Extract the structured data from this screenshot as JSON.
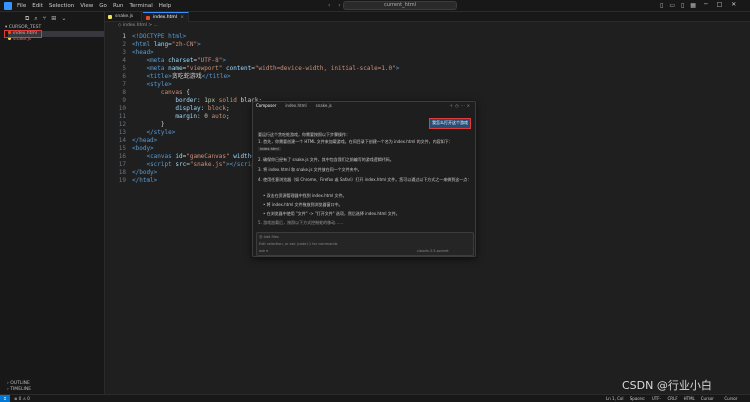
{
  "menu": [
    "File",
    "Edit",
    "Selection",
    "View",
    "Go",
    "Run",
    "Terminal",
    "Help"
  ],
  "command_center": "current_html",
  "sidebar": {
    "header": "CURSOR_TEST",
    "files": [
      {
        "name": "index.html",
        "color": "#e44d26",
        "selected": true
      },
      {
        "name": "snake.js",
        "color": "#f1e05a",
        "selected": false
      }
    ],
    "outline": "OUTLINE",
    "timeline": "TIMELINE"
  },
  "tabs": [
    {
      "name": "snake.js",
      "color": "#f1e05a",
      "active": false
    },
    {
      "name": "index.html",
      "color": "#e44d26",
      "active": true
    }
  ],
  "breadcrumb": "◇ index.html > ...",
  "code_lines": [
    {
      "n": "1",
      "html": "<span class='tg'>&lt;!DOCTYPE html&gt;</span>"
    },
    {
      "n": "2",
      "html": "<span class='tg'>&lt;html</span> <span class='at'>lang</span>=<span class='av'>\"zh-CN\"</span><span class='tg'>&gt;</span>"
    },
    {
      "n": "3",
      "html": "<span class='tg'>&lt;head&gt;</span>"
    },
    {
      "n": "4",
      "html": "    <span class='tg'>&lt;meta</span> <span class='at'>charset</span>=<span class='av'>\"UTF-8\"</span><span class='tg'>&gt;</span>"
    },
    {
      "n": "5",
      "html": "    <span class='tg'>&lt;meta</span> <span class='at'>name</span>=<span class='av'>\"viewport\"</span> <span class='at'>content</span>=<span class='av'>\"width=device-width, initial-scale=1.0\"</span><span class='tg'>&gt;</span>"
    },
    {
      "n": "6",
      "html": "    <span class='tg'>&lt;title&gt;</span><span class='tx'>贪吃蛇游戏</span><span class='tg'>&lt;/title&gt;</span>"
    },
    {
      "n": "7",
      "html": "    <span class='tg'>&lt;style&gt;</span>"
    },
    {
      "n": "8",
      "html": "        <span class='av'>canvas</span> <span class='tx'>{</span>"
    },
    {
      "n": "9",
      "html": "            <span class='pr'>border</span><span class='tx'>:</span> <span class='nm'>1px</span> <span class='av'>solid</span> <span class='tx'>black;</span>"
    },
    {
      "n": "10",
      "html": "            <span class='pr'>display</span><span class='tx'>:</span> <span class='av'>block</span><span class='tx'>;</span>"
    },
    {
      "n": "11",
      "html": "            <span class='pr'>margin</span><span class='tx'>:</span> <span class='nm'>0</span> <span class='av'>auto</span><span class='tx'>;</span>"
    },
    {
      "n": "12",
      "html": "        <span class='tx'>}</span>"
    },
    {
      "n": "13",
      "html": "    <span class='tg'>&lt;/style&gt;</span>"
    },
    {
      "n": "14",
      "html": "<span class='tg'>&lt;/head&gt;</span>"
    },
    {
      "n": "15",
      "html": "<span class='tg'>&lt;body&gt;</span>"
    },
    {
      "n": "16",
      "html": "    <span class='tg'>&lt;canvas</span> <span class='at'>id</span>=<span class='av'>\"gameCanvas\"</span> <span class='at'>width</span>=<span class='av'>\"400\"</span><span class='tg'>&gt;</span>"
    },
    {
      "n": "17",
      "html": "    <span class='tg'>&lt;script</span> <span class='at'>src</span>=<span class='av'>\"snake.js\"</span><span class='tg'>&gt;&lt;/script&gt;</span>"
    },
    {
      "n": "18",
      "html": "<span class='tg'>&lt;/body&gt;</span>"
    },
    {
      "n": "19",
      "html": "<span class='tg'>&lt;/html&gt;</span>"
    }
  ],
  "chat": {
    "tabs": [
      "Composer",
      "index.html",
      "snake.js"
    ],
    "user_message": "我怎么打开这个游戏",
    "intro": "要运行这个贪吃蛇游戏，你需要按照以下步骤操作：",
    "step1": "1. 首先，你需要创建一个 HTML 文件来加载游戏。在同目录下创建一个名为 index.html 的文件，内容如下：",
    "ref": "index.html",
    "step2": "2. 确保你已经有了 snake.js 文件，其中包含我们之前编写的游戏逻辑代码。",
    "step3": "3. 将 index.html 和 snake.js 文件放在同一个文件夹中。",
    "step4": "4. 使用任意浏览器（如 Chrome、Firefox 或 Safari）打开 index.html 文件。您可以通过以下方式之一来做到这一点：",
    "bullet1": "双击在资源管理器中找到 index.html 文件。",
    "bullet2": "将 index.html 文件拖放到浏览器窗口中。",
    "bullet3": "在浏览器中使用 \"文件\" -> \"打开文件\" 选项，然后选择 index.html 文件。",
    "more": "5. 游戏加载后，按照以下方式控制蛇的移动……",
    "input_label": "Add files",
    "input_placeholder": "Edit selection, or ask (code) 1 for commands",
    "model": "claude-3.5-sonnet"
  },
  "statusbar": {
    "left": "⊗ 0  ⚠ 0",
    "right": [
      "Ln 1, Col 1",
      "Spaces: 4",
      "UTF-8",
      "CRLF",
      "HTML",
      "Cursor Tab",
      "Cursor Settings"
    ]
  },
  "watermark": "CSDN @行业小白"
}
